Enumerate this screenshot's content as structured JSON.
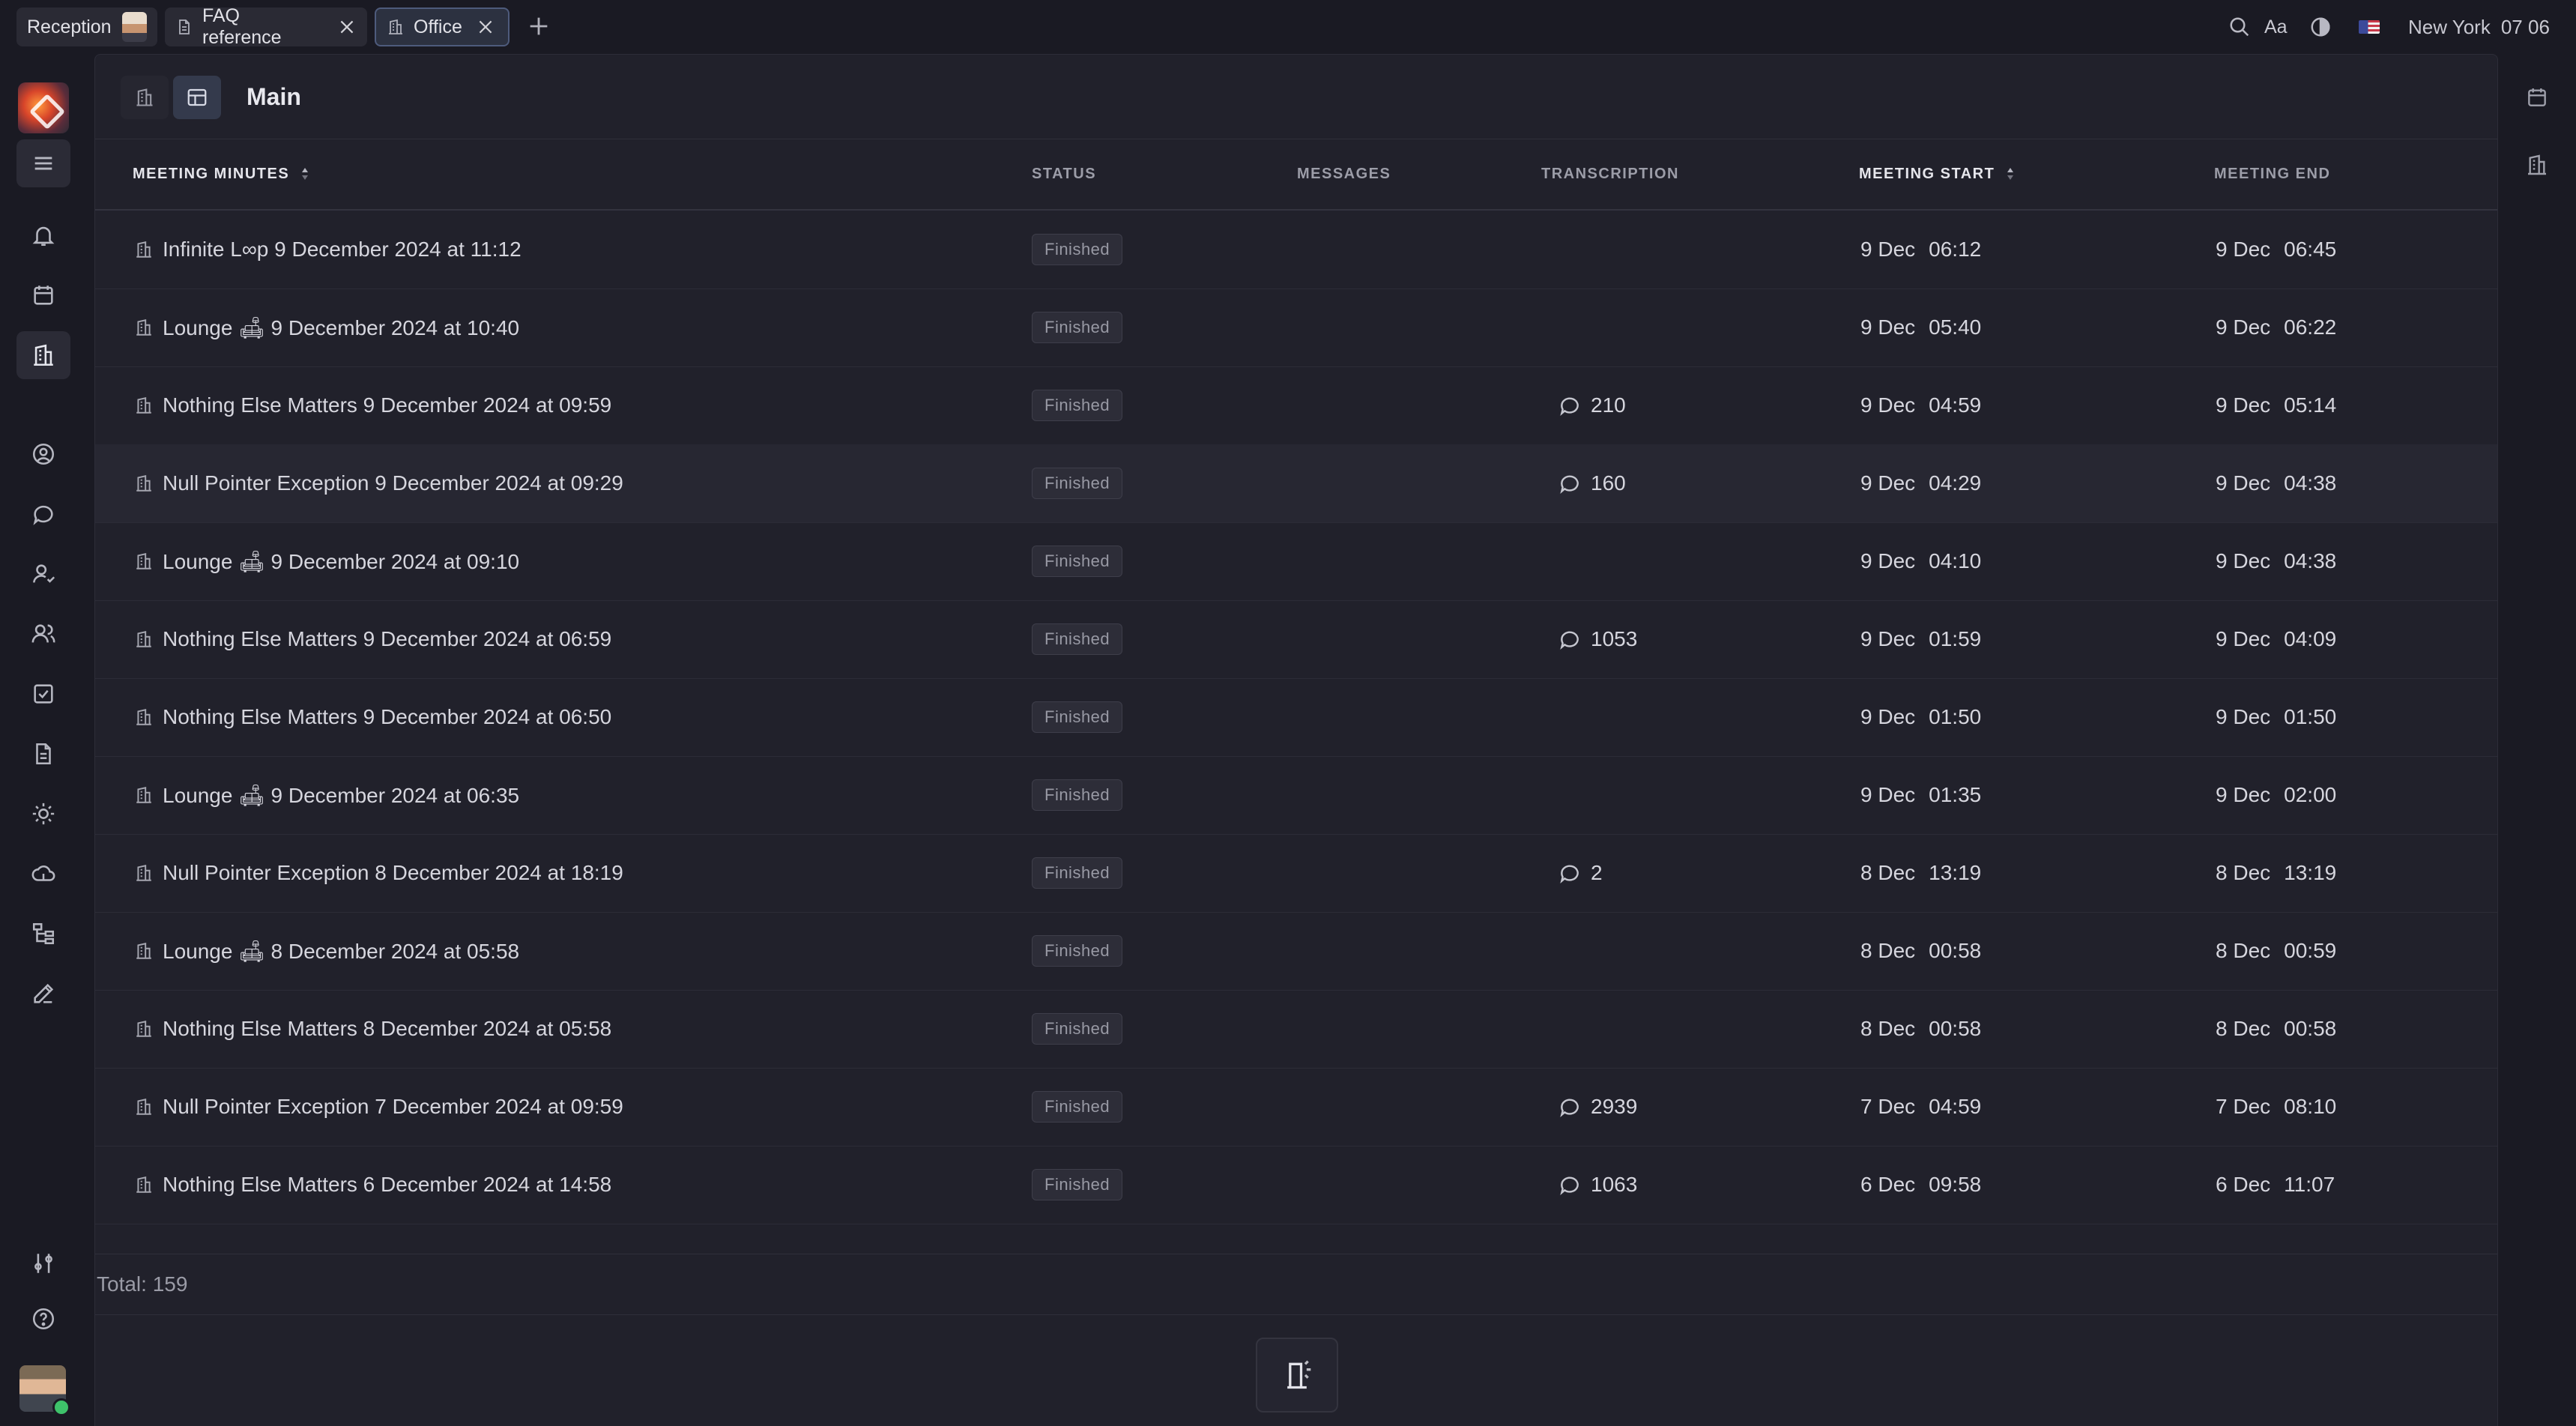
{
  "tabs": [
    {
      "label": "Reception"
    },
    {
      "label": "FAQ reference"
    },
    {
      "label": "Office"
    }
  ],
  "top_right": {
    "font_label": "Aa",
    "location": "New York",
    "time": "07 06"
  },
  "panel": {
    "title": "Main"
  },
  "table": {
    "headers": {
      "meeting_minutes": "MEETING MINUTES",
      "status": "STATUS",
      "messages": "MESSAGES",
      "transcription": "TRANSCRIPTION",
      "meeting_start": "MEETING START",
      "meeting_end": "MEETING END"
    },
    "rows": [
      {
        "title": "Infinite L∞p 9 December 2024 at 11:12",
        "status": "Finished",
        "transcription": "",
        "start_date": "9 Dec",
        "start_time": "06:12",
        "end_date": "9 Dec",
        "end_time": "06:45"
      },
      {
        "title": "Lounge 🛋 9 December 2024 at 10:40",
        "status": "Finished",
        "transcription": "",
        "start_date": "9 Dec",
        "start_time": "05:40",
        "end_date": "9 Dec",
        "end_time": "06:22"
      },
      {
        "title": "Nothing Else Matters 9 December 2024 at 09:59",
        "status": "Finished",
        "transcription": "210",
        "start_date": "9 Dec",
        "start_time": "04:59",
        "end_date": "9 Dec",
        "end_time": "05:14"
      },
      {
        "title": "Null Pointer Exception 9 December 2024 at 09:29",
        "status": "Finished",
        "transcription": "160",
        "start_date": "9 Dec",
        "start_time": "04:29",
        "end_date": "9 Dec",
        "end_time": "04:38"
      },
      {
        "title": "Lounge 🛋 9 December 2024 at 09:10",
        "status": "Finished",
        "transcription": "",
        "start_date": "9 Dec",
        "start_time": "04:10",
        "end_date": "9 Dec",
        "end_time": "04:38"
      },
      {
        "title": "Nothing Else Matters 9 December 2024 at 06:59",
        "status": "Finished",
        "transcription": "1053",
        "start_date": "9 Dec",
        "start_time": "01:59",
        "end_date": "9 Dec",
        "end_time": "04:09"
      },
      {
        "title": "Nothing Else Matters 9 December 2024 at 06:50",
        "status": "Finished",
        "transcription": "",
        "start_date": "9 Dec",
        "start_time": "01:50",
        "end_date": "9 Dec",
        "end_time": "01:50"
      },
      {
        "title": "Lounge 🛋 9 December 2024 at 06:35",
        "status": "Finished",
        "transcription": "",
        "start_date": "9 Dec",
        "start_time": "01:35",
        "end_date": "9 Dec",
        "end_time": "02:00"
      },
      {
        "title": "Null Pointer Exception 8 December 2024 at 18:19",
        "status": "Finished",
        "transcription": "2",
        "start_date": "8 Dec",
        "start_time": "13:19",
        "end_date": "8 Dec",
        "end_time": "13:19"
      },
      {
        "title": "Lounge 🛋 8 December 2024 at 05:58",
        "status": "Finished",
        "transcription": "",
        "start_date": "8 Dec",
        "start_time": "00:58",
        "end_date": "8 Dec",
        "end_time": "00:59"
      },
      {
        "title": "Nothing Else Matters 8 December 2024 at 05:58",
        "status": "Finished",
        "transcription": "",
        "start_date": "8 Dec",
        "start_time": "00:58",
        "end_date": "8 Dec",
        "end_time": "00:58"
      },
      {
        "title": "Null Pointer Exception 7 December 2024 at 09:59",
        "status": "Finished",
        "transcription": "2939",
        "start_date": "7 Dec",
        "start_time": "04:59",
        "end_date": "7 Dec",
        "end_time": "08:10"
      },
      {
        "title": "Nothing Else Matters 6 December 2024 at 14:58",
        "status": "Finished",
        "transcription": "1063",
        "start_date": "6 Dec",
        "start_time": "09:58",
        "end_date": "6 Dec",
        "end_time": "11:07"
      }
    ],
    "total": "Total: 159"
  },
  "icons": {
    "rail": [
      "app-logo",
      "menu-icon",
      "bell-icon",
      "calendar-icon",
      "office-icon",
      "contact-icon",
      "chat-icon",
      "person-icon",
      "people-icon",
      "tasks-icon",
      "document-icon",
      "sun-icon",
      "cloud-icon",
      "hierarchy-icon",
      "edit-icon",
      "settings-sliders-icon",
      "help-icon"
    ],
    "right_rail": [
      "calendar-icon",
      "office-icon"
    ]
  },
  "colors": {
    "background": "#1a1a23",
    "panel": "#21212b",
    "active_tab_border": "#4e5b7c",
    "status_badge": "#2d2d38",
    "online_indicator": "#3ec26a"
  }
}
